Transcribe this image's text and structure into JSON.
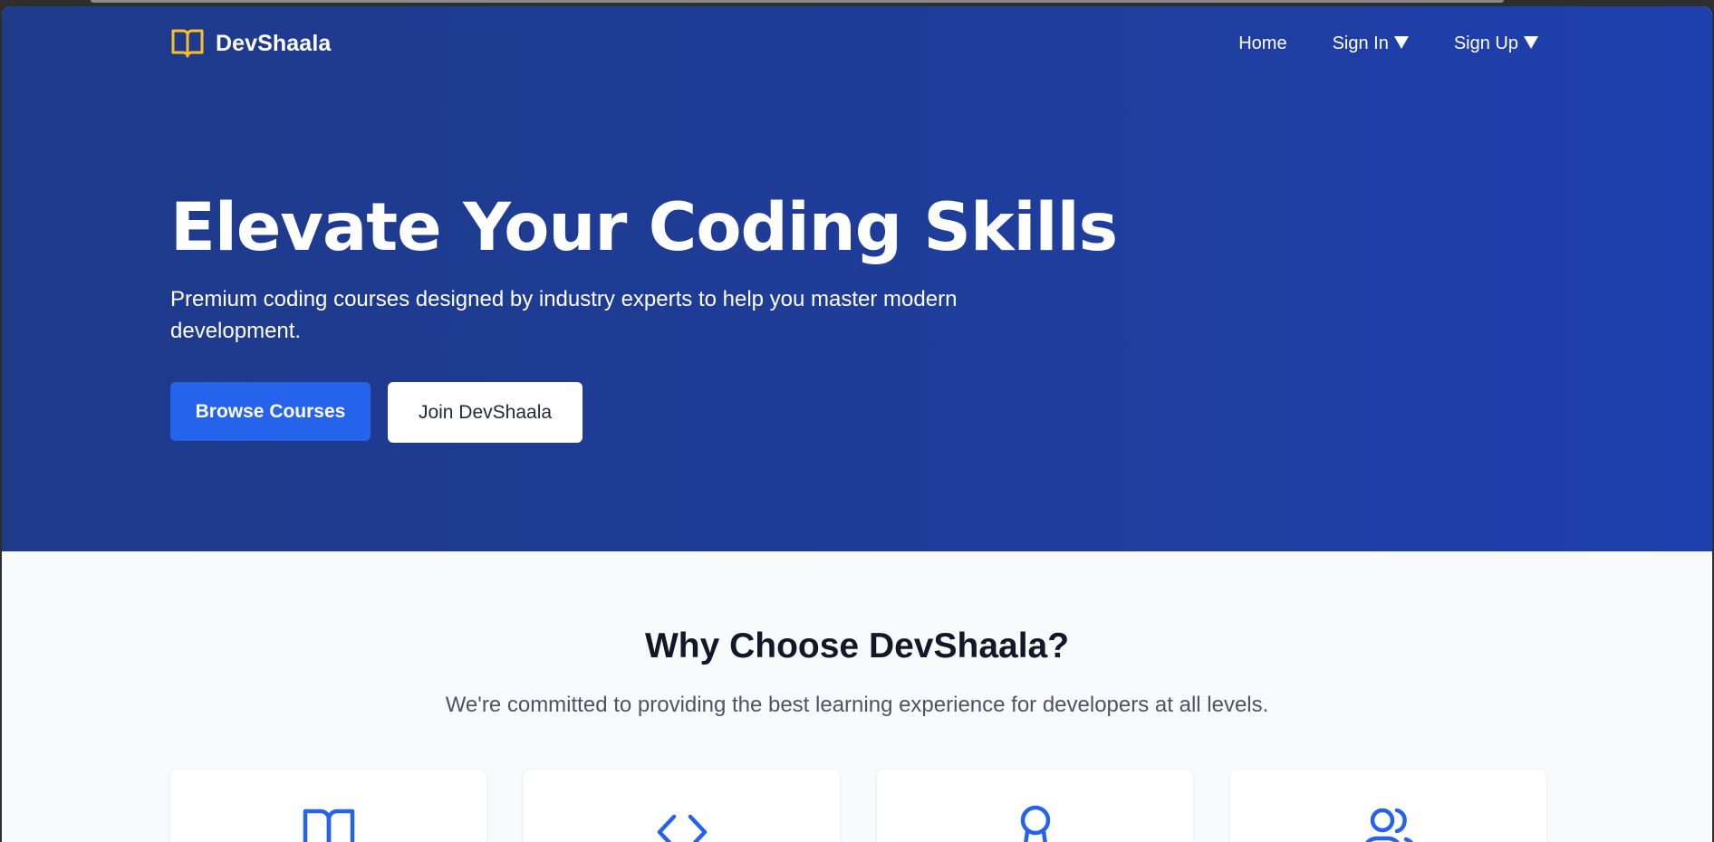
{
  "brand": {
    "name": "DevShaala",
    "icon": "open-book-icon",
    "icon_color": "#fbbf24"
  },
  "nav": {
    "home": "Home",
    "sign_in": "Sign In",
    "sign_up": "Sign Up"
  },
  "hero": {
    "title": "Elevate Your Coding Skills",
    "subtitle": "Premium coding courses designed by industry experts to help you master modern development.",
    "primary_button": "Browse Courses",
    "secondary_button": "Join DevShaala",
    "background_color": "#1e3a8a"
  },
  "features": {
    "title": "Why Choose DevShaala?",
    "subtitle": "We're committed to providing the best learning experience for developers at all levels.",
    "cards": [
      {
        "icon": "book-icon"
      },
      {
        "icon": "code-icon"
      },
      {
        "icon": "award-icon"
      },
      {
        "icon": "users-icon"
      }
    ],
    "icon_color": "#2563eb"
  }
}
